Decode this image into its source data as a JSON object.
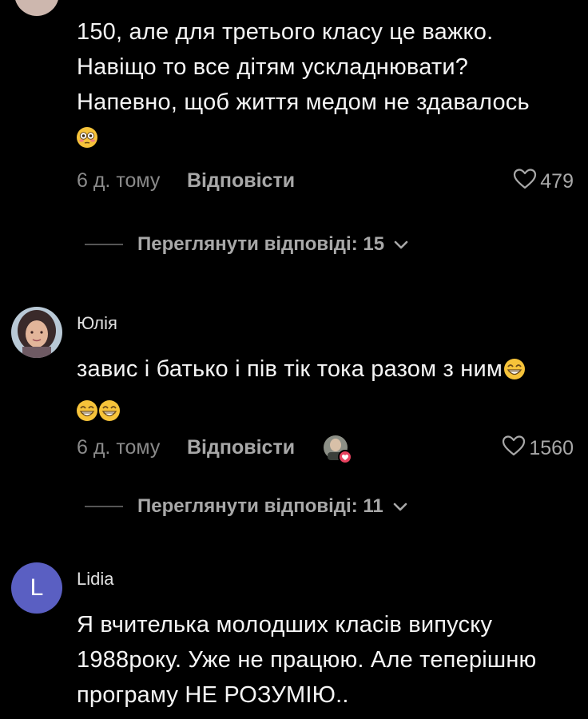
{
  "comments": [
    {
      "lines": [
        "150, але для третього класу це важко.",
        "Навіщо то все дітям ускладнювати?",
        "Напевно, щоб життя медом не здавалось"
      ],
      "emoji": "flushed-face",
      "time": "6 д. тому",
      "reply_label": "Відповісти",
      "likes": "479",
      "view_replies": "Переглянути відповіді: 15"
    },
    {
      "username": "Юлія",
      "lines": [
        "завис і батько і пів тік тока разом з ним",
        ""
      ],
      "emoji": "grinning-face",
      "time": "6 д. тому",
      "reply_label": "Відповісти",
      "likes": "1560",
      "view_replies": "Переглянути відповіді: 11"
    },
    {
      "username": "Lidia",
      "avatar_letter": "L",
      "avatar_color": "#5a5fc2",
      "lines": [
        "Я вчителька молодших класів випуску",
        "1988року. Уже не працюю. Але теперішню",
        "програму НЕ РОЗУМІЮ.."
      ]
    }
  ],
  "colors": {
    "background": "#000000",
    "text": "#f5f5f5",
    "muted": "#8a8a8a",
    "liked_badge": "#e8425f"
  }
}
